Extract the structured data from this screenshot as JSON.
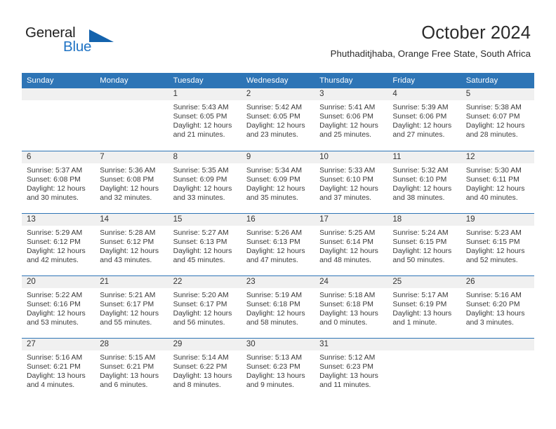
{
  "brand": {
    "word_one": "General",
    "word_two": "Blue",
    "logo_icon": "triangle-logo-icon",
    "accent_color": "#1463ad"
  },
  "header": {
    "title": "October 2024",
    "subtitle": "Phuthaditjhaba, Orange Free State, South Africa"
  },
  "theme": {
    "header_blue": "#2e75b6",
    "daynum_gray": "#f0f0f0",
    "text_color": "#3a3a3a"
  },
  "calendar": {
    "weekday_headers": [
      "Sunday",
      "Monday",
      "Tuesday",
      "Wednesday",
      "Thursday",
      "Friday",
      "Saturday"
    ],
    "weeks": [
      [
        {
          "day": "",
          "sunrise": "",
          "sunset": "",
          "daylight": ""
        },
        {
          "day": "",
          "sunrise": "",
          "sunset": "",
          "daylight": ""
        },
        {
          "day": "1",
          "sunrise": "Sunrise: 5:43 AM",
          "sunset": "Sunset: 6:05 PM",
          "daylight": "Daylight: 12 hours and 21 minutes."
        },
        {
          "day": "2",
          "sunrise": "Sunrise: 5:42 AM",
          "sunset": "Sunset: 6:05 PM",
          "daylight": "Daylight: 12 hours and 23 minutes."
        },
        {
          "day": "3",
          "sunrise": "Sunrise: 5:41 AM",
          "sunset": "Sunset: 6:06 PM",
          "daylight": "Daylight: 12 hours and 25 minutes."
        },
        {
          "day": "4",
          "sunrise": "Sunrise: 5:39 AM",
          "sunset": "Sunset: 6:06 PM",
          "daylight": "Daylight: 12 hours and 27 minutes."
        },
        {
          "day": "5",
          "sunrise": "Sunrise: 5:38 AM",
          "sunset": "Sunset: 6:07 PM",
          "daylight": "Daylight: 12 hours and 28 minutes."
        }
      ],
      [
        {
          "day": "6",
          "sunrise": "Sunrise: 5:37 AM",
          "sunset": "Sunset: 6:08 PM",
          "daylight": "Daylight: 12 hours and 30 minutes."
        },
        {
          "day": "7",
          "sunrise": "Sunrise: 5:36 AM",
          "sunset": "Sunset: 6:08 PM",
          "daylight": "Daylight: 12 hours and 32 minutes."
        },
        {
          "day": "8",
          "sunrise": "Sunrise: 5:35 AM",
          "sunset": "Sunset: 6:09 PM",
          "daylight": "Daylight: 12 hours and 33 minutes."
        },
        {
          "day": "9",
          "sunrise": "Sunrise: 5:34 AM",
          "sunset": "Sunset: 6:09 PM",
          "daylight": "Daylight: 12 hours and 35 minutes."
        },
        {
          "day": "10",
          "sunrise": "Sunrise: 5:33 AM",
          "sunset": "Sunset: 6:10 PM",
          "daylight": "Daylight: 12 hours and 37 minutes."
        },
        {
          "day": "11",
          "sunrise": "Sunrise: 5:32 AM",
          "sunset": "Sunset: 6:10 PM",
          "daylight": "Daylight: 12 hours and 38 minutes."
        },
        {
          "day": "12",
          "sunrise": "Sunrise: 5:30 AM",
          "sunset": "Sunset: 6:11 PM",
          "daylight": "Daylight: 12 hours and 40 minutes."
        }
      ],
      [
        {
          "day": "13",
          "sunrise": "Sunrise: 5:29 AM",
          "sunset": "Sunset: 6:12 PM",
          "daylight": "Daylight: 12 hours and 42 minutes."
        },
        {
          "day": "14",
          "sunrise": "Sunrise: 5:28 AM",
          "sunset": "Sunset: 6:12 PM",
          "daylight": "Daylight: 12 hours and 43 minutes."
        },
        {
          "day": "15",
          "sunrise": "Sunrise: 5:27 AM",
          "sunset": "Sunset: 6:13 PM",
          "daylight": "Daylight: 12 hours and 45 minutes."
        },
        {
          "day": "16",
          "sunrise": "Sunrise: 5:26 AM",
          "sunset": "Sunset: 6:13 PM",
          "daylight": "Daylight: 12 hours and 47 minutes."
        },
        {
          "day": "17",
          "sunrise": "Sunrise: 5:25 AM",
          "sunset": "Sunset: 6:14 PM",
          "daylight": "Daylight: 12 hours and 48 minutes."
        },
        {
          "day": "18",
          "sunrise": "Sunrise: 5:24 AM",
          "sunset": "Sunset: 6:15 PM",
          "daylight": "Daylight: 12 hours and 50 minutes."
        },
        {
          "day": "19",
          "sunrise": "Sunrise: 5:23 AM",
          "sunset": "Sunset: 6:15 PM",
          "daylight": "Daylight: 12 hours and 52 minutes."
        }
      ],
      [
        {
          "day": "20",
          "sunrise": "Sunrise: 5:22 AM",
          "sunset": "Sunset: 6:16 PM",
          "daylight": "Daylight: 12 hours and 53 minutes."
        },
        {
          "day": "21",
          "sunrise": "Sunrise: 5:21 AM",
          "sunset": "Sunset: 6:17 PM",
          "daylight": "Daylight: 12 hours and 55 minutes."
        },
        {
          "day": "22",
          "sunrise": "Sunrise: 5:20 AM",
          "sunset": "Sunset: 6:17 PM",
          "daylight": "Daylight: 12 hours and 56 minutes."
        },
        {
          "day": "23",
          "sunrise": "Sunrise: 5:19 AM",
          "sunset": "Sunset: 6:18 PM",
          "daylight": "Daylight: 12 hours and 58 minutes."
        },
        {
          "day": "24",
          "sunrise": "Sunrise: 5:18 AM",
          "sunset": "Sunset: 6:18 PM",
          "daylight": "Daylight: 13 hours and 0 minutes."
        },
        {
          "day": "25",
          "sunrise": "Sunrise: 5:17 AM",
          "sunset": "Sunset: 6:19 PM",
          "daylight": "Daylight: 13 hours and 1 minute."
        },
        {
          "day": "26",
          "sunrise": "Sunrise: 5:16 AM",
          "sunset": "Sunset: 6:20 PM",
          "daylight": "Daylight: 13 hours and 3 minutes."
        }
      ],
      [
        {
          "day": "27",
          "sunrise": "Sunrise: 5:16 AM",
          "sunset": "Sunset: 6:21 PM",
          "daylight": "Daylight: 13 hours and 4 minutes."
        },
        {
          "day": "28",
          "sunrise": "Sunrise: 5:15 AM",
          "sunset": "Sunset: 6:21 PM",
          "daylight": "Daylight: 13 hours and 6 minutes."
        },
        {
          "day": "29",
          "sunrise": "Sunrise: 5:14 AM",
          "sunset": "Sunset: 6:22 PM",
          "daylight": "Daylight: 13 hours and 8 minutes."
        },
        {
          "day": "30",
          "sunrise": "Sunrise: 5:13 AM",
          "sunset": "Sunset: 6:23 PM",
          "daylight": "Daylight: 13 hours and 9 minutes."
        },
        {
          "day": "31",
          "sunrise": "Sunrise: 5:12 AM",
          "sunset": "Sunset: 6:23 PM",
          "daylight": "Daylight: 13 hours and 11 minutes."
        },
        {
          "day": "",
          "sunrise": "",
          "sunset": "",
          "daylight": ""
        },
        {
          "day": "",
          "sunrise": "",
          "sunset": "",
          "daylight": ""
        }
      ]
    ]
  }
}
